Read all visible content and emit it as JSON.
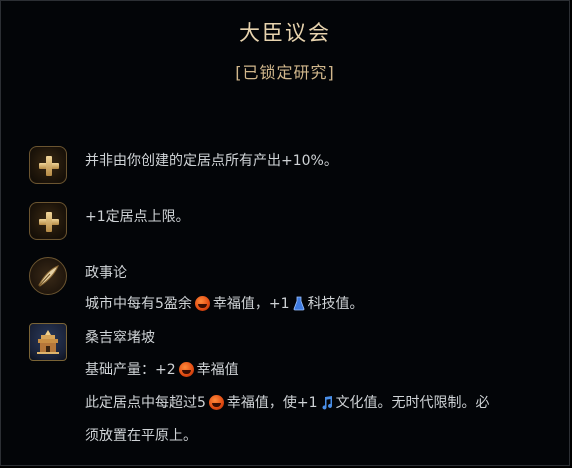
{
  "panel": {
    "title": "大臣议会",
    "subtitle": "[已锁定研究]"
  },
  "effects": [
    {
      "icon": "plus-icon",
      "text": "并非由你创建的定居点所有产出+10%。"
    },
    {
      "icon": "plus-icon",
      "text": "+1定居点上限。"
    }
  ],
  "policy": {
    "icon": "quill-icon",
    "name": "政事论",
    "desc_before": "城市中每有5盈余",
    "desc_mid": "幸福值，+1",
    "desc_after": "科技值。"
  },
  "district": {
    "icon": "palace-icon",
    "name": "桑吉窣堵坡",
    "base_before": "基础产量：+2",
    "base_after": "幸福值",
    "line1_before": "此定居点中每超过5",
    "line1_mid": "幸福值，使+1",
    "line1_after": "文化值。无时代限制。必",
    "line2": "须放置在平原上。"
  },
  "icons": {
    "happiness": "happiness-icon",
    "science": "science-flask-icon",
    "culture": "culture-note-icon"
  },
  "colors": {
    "title": "#e7d3ae",
    "subtitle": "#d1b78c",
    "body_text": "#cfd3d6",
    "background": "#030508"
  }
}
